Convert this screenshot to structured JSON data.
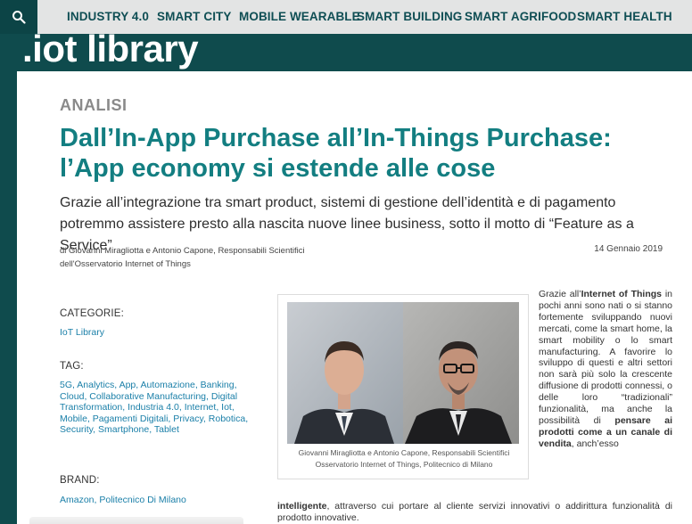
{
  "nav": {
    "items": [
      "INDUSTRY 4.0",
      "SMART CITY",
      "MOBILE WEARABLE",
      "SMART BUILDING",
      "SMART AGRIFOOD",
      "SMART HEALTH"
    ]
  },
  "brand": {
    "name": ".iot library"
  },
  "article": {
    "kicker": "ANALISI",
    "title": "Dall’In-App Purchase all’In-Things Purchase: l’App economy si estende alle cose",
    "subtitle": "Grazie all’integrazione tra smart product, sistemi di gestione dell’identità e di pagamento potremmo assistere presto alla nascita nuove linee business, sotto il motto di “Feature as a Service”",
    "byline": "di Giovanni Miragliotta e Antonio Capone, Responsabili Scientifici dell'Osservatorio Internet of Things",
    "date": "14 Gennaio 2019",
    "image_caption": "Giovanni Miragliotta e Antonio Capone, Responsabili Scientifici Osservatorio Internet of Things, Politecnico di Milano",
    "body": {
      "p1": "Grazie all’",
      "p1_bold1": "Internet of Things",
      "p2": " in pochi anni sono nati o si stanno fortemente sviluppando nuovi mercati, come la smart home, la smart mobility o lo smart manufacturing. A favorire lo sviluppo di questi e altri settori non sarà più solo la crescente diffusione di prodotti connessi, o delle loro “tradizionali” funzionalità, ma anche la possibilità di ",
      "p2_bold": "pensare ai prodotti come a un canale di vendita",
      "p3": ", anch’esso",
      "cont_bold": "intelligente",
      "cont": ", attraverso cui portare al cliente servizi innovativi o addirittura funzionalità di prodotto innovative."
    }
  },
  "sidebar": {
    "categories_label": "CATEGORIE:",
    "categories": [
      "IoT Library"
    ],
    "tags_label": "TAG:",
    "tags": [
      "5G",
      "Analytics",
      "App",
      "Automazione",
      "Banking",
      "Cloud",
      "Collaborative Manufacturing",
      "Digital Transformation",
      "Industria 4.0",
      "Internet",
      "Iot",
      "Mobile",
      "Pagamenti Digitali",
      "Privacy",
      "Robotica",
      "Security",
      "Smartphone",
      "Tablet"
    ],
    "brand_label": "BRAND:",
    "brands": [
      "Amazon",
      "Politecnico Di Milano"
    ]
  },
  "colors": {
    "teal_dark": "#0f4b4d",
    "title_teal": "#137e81",
    "link_blue": "#1a7fa8",
    "nav_bg": "#e3e4e4"
  },
  "icons": {
    "search": "search-icon"
  }
}
